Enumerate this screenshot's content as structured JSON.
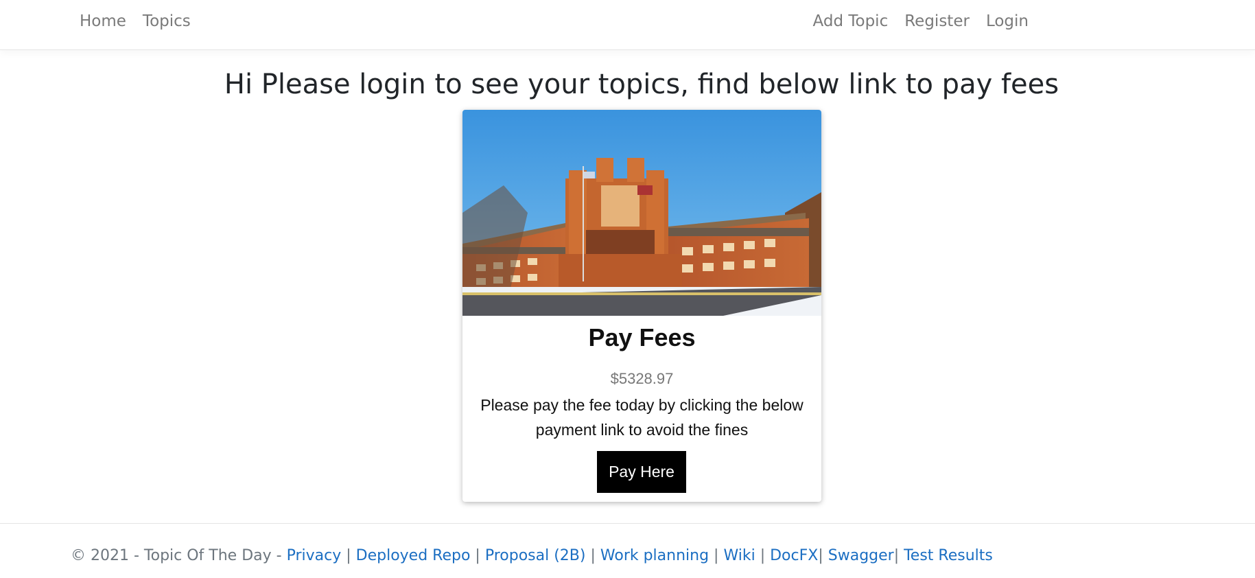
{
  "nav": {
    "left": [
      {
        "label": "Home"
      },
      {
        "label": "Topics"
      }
    ],
    "right": [
      {
        "label": "Add Topic"
      },
      {
        "label": "Register"
      },
      {
        "label": "Login"
      }
    ]
  },
  "main": {
    "heading": "Hi Please login to see your topics, find below link to pay fees"
  },
  "card": {
    "image_alt": "school building photo",
    "title": "Pay Fees",
    "price": "$5328.97",
    "text": "Please pay the fee today by clicking the below payment link to avoid the fines",
    "button_label": "Pay Here"
  },
  "footer": {
    "copyright": "© 2021 - Topic Of The Day - ",
    "links": [
      {
        "label": "Privacy"
      },
      {
        "label": "Deployed Repo"
      },
      {
        "label": "Proposal (2B)"
      },
      {
        "label": "Work planning"
      },
      {
        "label": "Wiki"
      },
      {
        "label": "DocFX"
      },
      {
        "label": "Swagger"
      },
      {
        "label": "Test Results"
      }
    ],
    "separator_spaced": " | ",
    "separator_tight": "| "
  },
  "colors": {
    "link": "#1b6ec2",
    "nav_text": "#7a7a7a",
    "button_bg": "#000000"
  }
}
